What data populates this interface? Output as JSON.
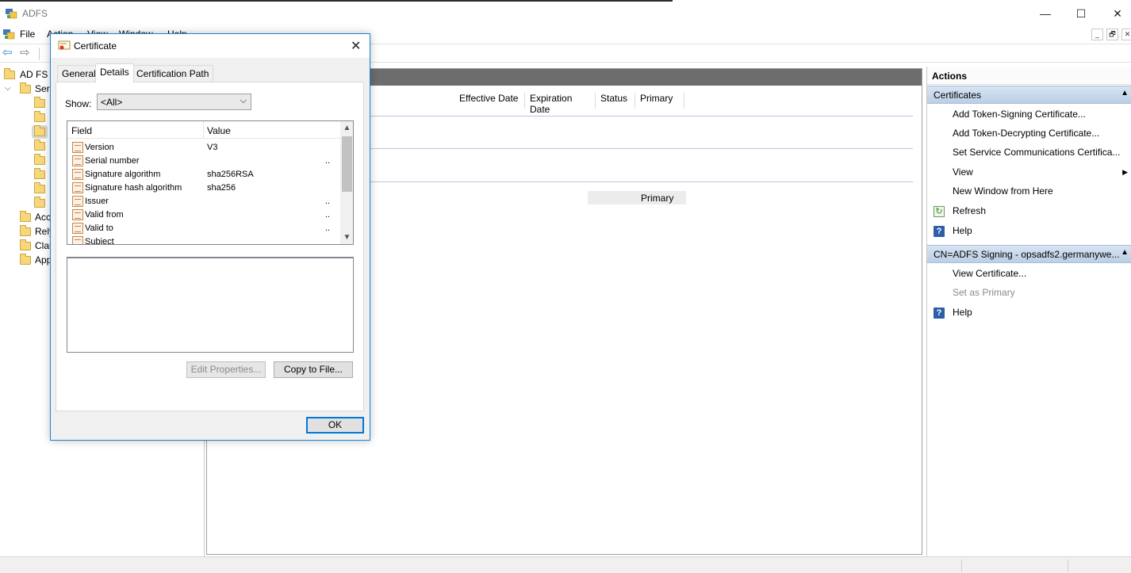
{
  "window": {
    "title": "ADFS",
    "minimize": "—",
    "maximize": "☐",
    "close": "✕"
  },
  "menu": {
    "items": [
      "File",
      "Action",
      "View",
      "Window",
      "Help"
    ],
    "mdi_minimize": "_",
    "mdi_restore": "🗗",
    "mdi_close": "✕"
  },
  "toolbar": {
    "back": "⇦",
    "forward": "⇨"
  },
  "tree": {
    "root": "AD FS",
    "service": "Serv",
    "children": [
      "Acc",
      "Rely",
      "Clai",
      "App"
    ]
  },
  "center": {
    "columns": [
      "Effective Date",
      "Expiration Date",
      "Status",
      "Primary"
    ],
    "row_status": "Primary"
  },
  "actions": {
    "title": "Actions",
    "section1": "Certificates",
    "items1": [
      "Add Token-Signing Certificate...",
      "Add Token-Decrypting Certificate...",
      "Set Service Communications Certifica...",
      "View",
      "New Window from Here",
      "Refresh",
      "Help"
    ],
    "section2": "CN=ADFS Signing - opsadfs2.germanywe...",
    "items2": [
      "View Certificate...",
      "Set as Primary",
      "Help"
    ]
  },
  "dialog": {
    "title": "Certificate",
    "close": "✕",
    "tabs": [
      "General",
      "Details",
      "Certification Path"
    ],
    "show_label": "Show:",
    "show_value": "<All>",
    "list_headers": {
      "field": "Field",
      "value": "Value"
    },
    "rows": [
      {
        "field": "Version",
        "value": "V3",
        "dots": ""
      },
      {
        "field": "Serial number",
        "value": "",
        "dots": ".."
      },
      {
        "field": "Signature algorithm",
        "value": "sha256RSA",
        "dots": ""
      },
      {
        "field": "Signature hash algorithm",
        "value": "sha256",
        "dots": ""
      },
      {
        "field": "Issuer",
        "value": "",
        "dots": ".."
      },
      {
        "field": "Valid from",
        "value": "",
        "dots": ".."
      },
      {
        "field": "Valid to",
        "value": "",
        "dots": ".."
      },
      {
        "field": "Subject",
        "value": "",
        "dots": ""
      }
    ],
    "edit_properties": "Edit Properties...",
    "copy_to_file": "Copy to File...",
    "ok": "OK"
  }
}
